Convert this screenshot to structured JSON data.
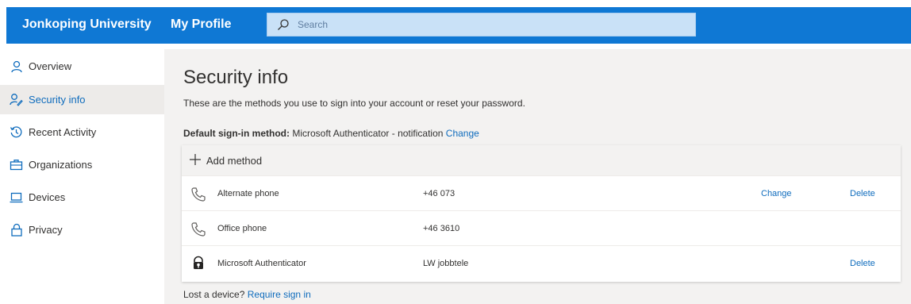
{
  "header": {
    "org_name": "Jonkoping University",
    "app_name": "My Profile",
    "search_placeholder": "Search"
  },
  "sidebar": {
    "items": [
      {
        "label": "Overview",
        "icon": "person-icon",
        "active": false
      },
      {
        "label": "Security info",
        "icon": "security-info-icon",
        "active": true
      },
      {
        "label": "Recent Activity",
        "icon": "history-icon",
        "active": false
      },
      {
        "label": "Organizations",
        "icon": "briefcase-icon",
        "active": false
      },
      {
        "label": "Devices",
        "icon": "laptop-icon",
        "active": false
      },
      {
        "label": "Privacy",
        "icon": "lock-icon",
        "active": false
      }
    ]
  },
  "main": {
    "title": "Security info",
    "subtitle": "These are the methods you use to sign into your account or reset your password.",
    "default_method_label": "Default sign-in method:",
    "default_method_value": "Microsoft Authenticator - notification",
    "default_method_change": "Change",
    "add_method_label": "Add method",
    "methods": [
      {
        "name": "Alternate phone",
        "value": "+46 073",
        "change": "Change",
        "delete": "Delete",
        "icon": "phone-icon"
      },
      {
        "name": "Office phone",
        "value": "+46 3610",
        "change": "",
        "delete": "",
        "icon": "phone-icon"
      },
      {
        "name": "Microsoft Authenticator",
        "value": "LW jobbtele",
        "change": "",
        "delete": "Delete",
        "icon": "authenticator-icon"
      }
    ],
    "lost_device_text": "Lost a device?",
    "lost_device_link": "Require sign in"
  },
  "colors": {
    "brand": "#0f78d4",
    "link": "#0f6cbd",
    "main_bg": "#f3f2f1",
    "active_nav_bg": "#edebe9"
  }
}
